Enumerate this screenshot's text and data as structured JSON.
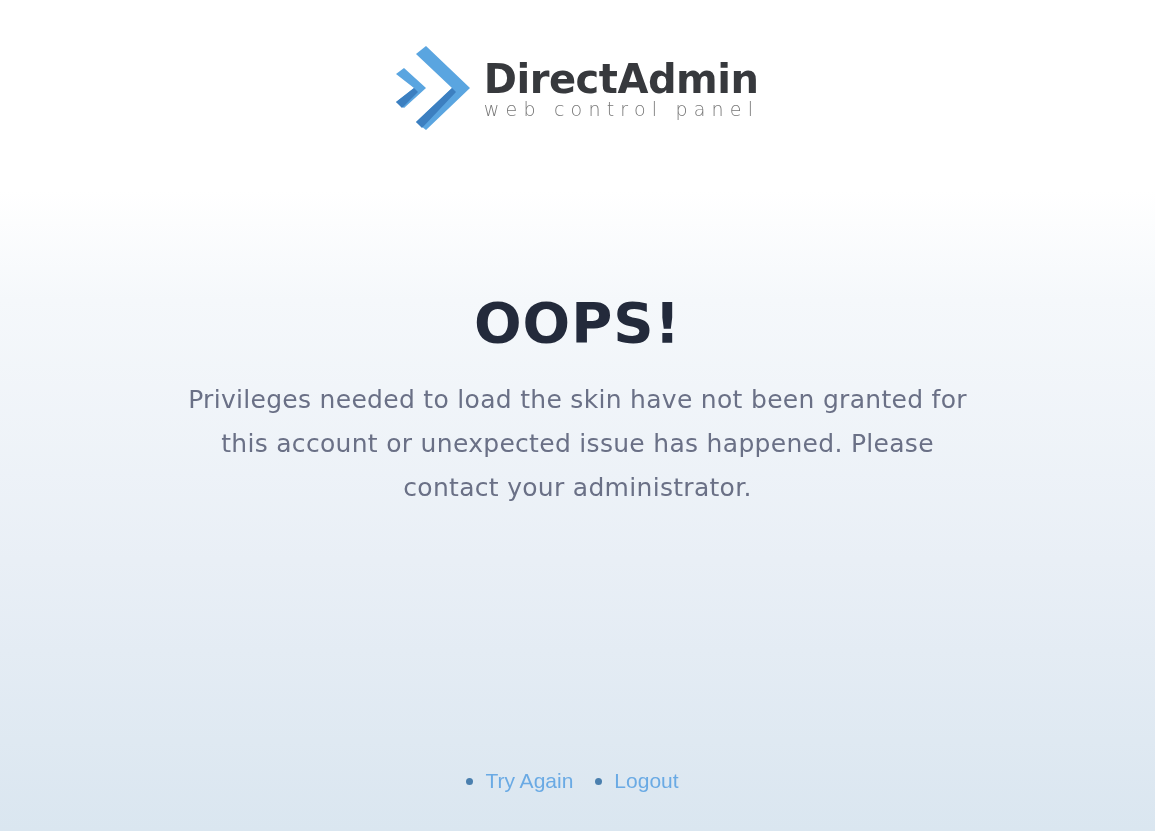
{
  "logo": {
    "name": "DirectAdmin",
    "tagline": "web control panel"
  },
  "error": {
    "title": "OOPS!",
    "message": "Privileges needed to load the skin have not been granted for this account or unexpected issue has happened. Please contact your administrator."
  },
  "links": [
    {
      "label": "Try Again"
    },
    {
      "label": "Logout"
    }
  ]
}
